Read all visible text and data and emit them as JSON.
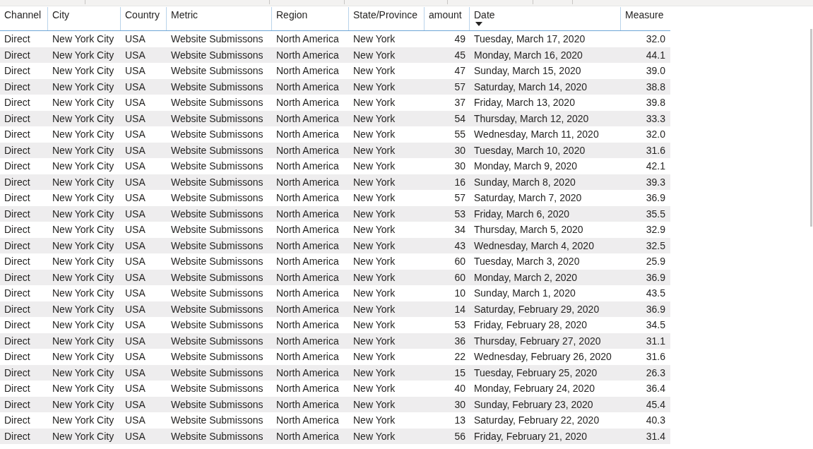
{
  "table": {
    "columns": [
      {
        "label": "Channel",
        "kind": "text",
        "sorted": false
      },
      {
        "label": "City",
        "kind": "text",
        "sorted": false
      },
      {
        "label": "Country",
        "kind": "text",
        "sorted": false
      },
      {
        "label": "Metric",
        "kind": "text",
        "sorted": false
      },
      {
        "label": "Region",
        "kind": "text",
        "sorted": false
      },
      {
        "label": "State/Province",
        "kind": "text",
        "sorted": false
      },
      {
        "label": "amount",
        "kind": "number",
        "sorted": false
      },
      {
        "label": "Date",
        "kind": "text",
        "sorted": true
      },
      {
        "label": "Measure",
        "kind": "number",
        "sorted": false
      }
    ],
    "rows": [
      [
        "Direct",
        "New York City",
        "USA",
        "Website Submissons",
        "North America",
        "New York",
        "49",
        "Tuesday, March 17, 2020",
        "32.0"
      ],
      [
        "Direct",
        "New York City",
        "USA",
        "Website Submissons",
        "North America",
        "New York",
        "45",
        "Monday, March 16, 2020",
        "44.1"
      ],
      [
        "Direct",
        "New York City",
        "USA",
        "Website Submissons",
        "North America",
        "New York",
        "47",
        "Sunday, March 15, 2020",
        "39.0"
      ],
      [
        "Direct",
        "New York City",
        "USA",
        "Website Submissons",
        "North America",
        "New York",
        "57",
        "Saturday, March 14, 2020",
        "38.8"
      ],
      [
        "Direct",
        "New York City",
        "USA",
        "Website Submissons",
        "North America",
        "New York",
        "37",
        "Friday, March 13, 2020",
        "39.8"
      ],
      [
        "Direct",
        "New York City",
        "USA",
        "Website Submissons",
        "North America",
        "New York",
        "54",
        "Thursday, March 12, 2020",
        "33.3"
      ],
      [
        "Direct",
        "New York City",
        "USA",
        "Website Submissons",
        "North America",
        "New York",
        "55",
        "Wednesday, March 11, 2020",
        "32.0"
      ],
      [
        "Direct",
        "New York City",
        "USA",
        "Website Submissons",
        "North America",
        "New York",
        "30",
        "Tuesday, March 10, 2020",
        "31.6"
      ],
      [
        "Direct",
        "New York City",
        "USA",
        "Website Submissons",
        "North America",
        "New York",
        "30",
        "Monday, March 9, 2020",
        "42.1"
      ],
      [
        "Direct",
        "New York City",
        "USA",
        "Website Submissons",
        "North America",
        "New York",
        "16",
        "Sunday, March 8, 2020",
        "39.3"
      ],
      [
        "Direct",
        "New York City",
        "USA",
        "Website Submissons",
        "North America",
        "New York",
        "57",
        "Saturday, March 7, 2020",
        "36.9"
      ],
      [
        "Direct",
        "New York City",
        "USA",
        "Website Submissons",
        "North America",
        "New York",
        "53",
        "Friday, March 6, 2020",
        "35.5"
      ],
      [
        "Direct",
        "New York City",
        "USA",
        "Website Submissons",
        "North America",
        "New York",
        "34",
        "Thursday, March 5, 2020",
        "32.9"
      ],
      [
        "Direct",
        "New York City",
        "USA",
        "Website Submissons",
        "North America",
        "New York",
        "43",
        "Wednesday, March 4, 2020",
        "32.5"
      ],
      [
        "Direct",
        "New York City",
        "USA",
        "Website Submissons",
        "North America",
        "New York",
        "60",
        "Tuesday, March 3, 2020",
        "25.9"
      ],
      [
        "Direct",
        "New York City",
        "USA",
        "Website Submissons",
        "North America",
        "New York",
        "60",
        "Monday, March 2, 2020",
        "36.9"
      ],
      [
        "Direct",
        "New York City",
        "USA",
        "Website Submissons",
        "North America",
        "New York",
        "10",
        "Sunday, March 1, 2020",
        "43.5"
      ],
      [
        "Direct",
        "New York City",
        "USA",
        "Website Submissons",
        "North America",
        "New York",
        "14",
        "Saturday, February 29, 2020",
        "36.9"
      ],
      [
        "Direct",
        "New York City",
        "USA",
        "Website Submissons",
        "North America",
        "New York",
        "53",
        "Friday, February 28, 2020",
        "34.5"
      ],
      [
        "Direct",
        "New York City",
        "USA",
        "Website Submissons",
        "North America",
        "New York",
        "36",
        "Thursday, February 27, 2020",
        "31.1"
      ],
      [
        "Direct",
        "New York City",
        "USA",
        "Website Submissons",
        "North America",
        "New York",
        "22",
        "Wednesday, February 26, 2020",
        "31.6"
      ],
      [
        "Direct",
        "New York City",
        "USA",
        "Website Submissons",
        "North America",
        "New York",
        "15",
        "Tuesday, February 25, 2020",
        "26.3"
      ],
      [
        "Direct",
        "New York City",
        "USA",
        "Website Submissons",
        "North America",
        "New York",
        "40",
        "Monday, February 24, 2020",
        "36.4"
      ],
      [
        "Direct",
        "New York City",
        "USA",
        "Website Submissons",
        "North America",
        "New York",
        "30",
        "Sunday, February 23, 2020",
        "45.4"
      ],
      [
        "Direct",
        "New York City",
        "USA",
        "Website Submissons",
        "North America",
        "New York",
        "13",
        "Saturday, February 22, 2020",
        "40.3"
      ],
      [
        "Direct",
        "New York City",
        "USA",
        "Website Submissons",
        "North America",
        "New York",
        "56",
        "Friday, February 21, 2020",
        "31.4"
      ]
    ]
  }
}
